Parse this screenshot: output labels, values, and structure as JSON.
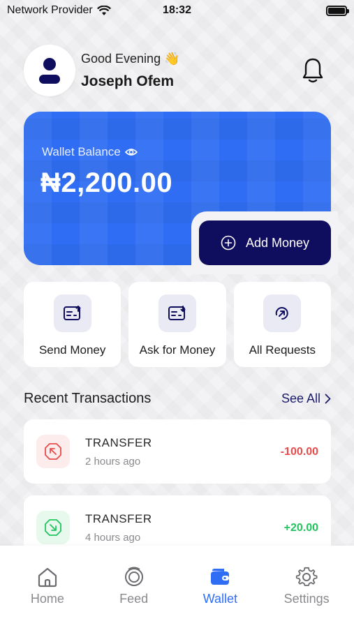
{
  "status_bar": {
    "carrier": "Network Provider",
    "time": "18:32"
  },
  "header": {
    "greeting": "Good Evening",
    "greeting_emoji": "👋",
    "user_name": "Joseph Ofem",
    "avatar_icon": "user-icon",
    "bell_icon": "bell-icon"
  },
  "wallet": {
    "label": "Wallet Balance",
    "eye_icon": "eye-icon",
    "balance": "₦2,200.00",
    "add_money_label": "Add Money",
    "card_color": "#2f6ef4",
    "button_color": "#0f0e5e"
  },
  "actions": [
    {
      "label": "Send Money",
      "icon": "send-money-icon"
    },
    {
      "label": "Ask for Money",
      "icon": "ask-money-icon"
    },
    {
      "label": "All Requests",
      "icon": "requests-icon"
    }
  ],
  "recent": {
    "title": "Recent Transactions",
    "see_all": "See All",
    "transactions": [
      {
        "type": "TRANSFER",
        "time": "2 hours ago",
        "amount": "-100.00",
        "direction": "out",
        "color": "#e74c4c"
      },
      {
        "type": "TRANSFER",
        "time": "4 hours ago",
        "amount": "+20.00",
        "direction": "in",
        "color": "#22c55e"
      }
    ]
  },
  "tabs": [
    {
      "label": "Home",
      "icon": "home-icon",
      "active": false
    },
    {
      "label": "Feed",
      "icon": "feed-icon",
      "active": false
    },
    {
      "label": "Wallet",
      "icon": "wallet-icon",
      "active": true
    },
    {
      "label": "Settings",
      "icon": "gear-icon",
      "active": false
    }
  ]
}
